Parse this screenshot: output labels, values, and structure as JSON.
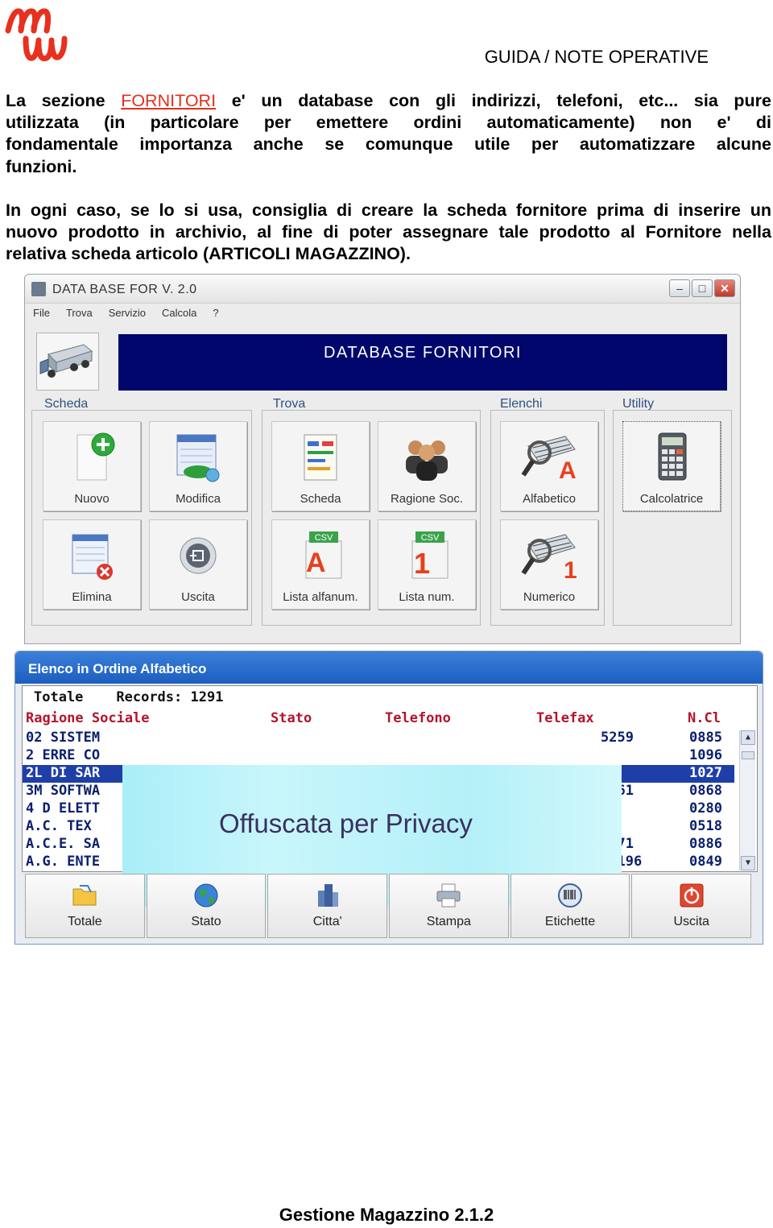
{
  "header": {
    "logo_text": "mw",
    "title": "GUIDA / NOTE OPERATIVE"
  },
  "intro": {
    "p1_before": "La sezione",
    "p1_link": "FORNITORI",
    "p1_l1_rest": "e' un database con gli indirizzi, telefoni, etc... sia pure",
    "p1_l2": "utilizzata (in particolare per emettere ordini automaticamente) non e' di",
    "p1_l3": "fondamentale importanza  anche se comunque utile per automatizzare alcune",
    "p1_l4": "funzioni.",
    "p2_l1": "In ogni caso, se lo si usa, consiglia di creare la scheda fornitore prima di inserire un",
    "p2_l2": "nuovo prodotto in archivio, al fine di poter assegnare tale prodotto al Fornitore nella",
    "p2_l3": "relativa scheda articolo (ARTICOLI MAGAZZINO)."
  },
  "window1": {
    "title": "DATA BASE FOR  V. 2.0",
    "menu": [
      "File",
      "Trova",
      "Servizio",
      "Calcola",
      "?"
    ],
    "banner": "DATABASE FORNITORI",
    "groups": {
      "scheda": "Scheda",
      "trova": "Trova",
      "elenchi": "Elenchi",
      "utility": "Utility"
    },
    "tiles": {
      "nuovo": "Nuovo",
      "modifica": "Modifica",
      "elimina": "Elimina",
      "uscita": "Uscita",
      "scheda": "Scheda",
      "ragione_soc": "Ragione Soc.",
      "lista_alfanum": "Lista alfanum.",
      "lista_num": "Lista num.",
      "alfabetico": "Alfabetico",
      "numerico": "Numerico",
      "calcolatrice": "Calcolatrice",
      "csv": "CSV"
    }
  },
  "window2": {
    "title": "Elenco in Ordine Alfabetico",
    "totals_label": "Totale",
    "records_label": "Records:",
    "records_count": "1291",
    "columns": [
      "Ragione Sociale",
      "Stato",
      "Telefono",
      "Telefax",
      "N.Cl"
    ],
    "rows": [
      {
        "name": "02 SISTEM",
        "fax": "5259",
        "ncl": "0885"
      },
      {
        "name": "2 ERRE CO",
        "fax": "",
        "ncl": "1096"
      },
      {
        "name": "2L DI SAR",
        "fax": "",
        "ncl": "1027"
      },
      {
        "name": "3M SOFTWA",
        "fax": "9161",
        "ncl": "0868"
      },
      {
        "name": "4 D ELETT",
        "fax": "",
        "ncl": "0280"
      },
      {
        "name": "A.C. TEX",
        "fax": "",
        "ncl": "0518"
      },
      {
        "name": "A.C.E. SA",
        "fax": "3371",
        "ncl": "0886"
      },
      {
        "name": "A.G. ENTE",
        "fax": "33196",
        "ncl": "0849"
      }
    ],
    "privacy_overlay": "Offuscata per Privacy",
    "buttons": {
      "totale": "Totale",
      "stato": "Stato",
      "citta": "Citta'",
      "stampa": "Stampa",
      "etichette": "Etichette",
      "uscita": "Uscita"
    }
  },
  "footer": "Gestione Magazzino  2.1.2",
  "colors": {
    "link": "#e0301e",
    "banner": "#00066b",
    "list_text": "#0a1f6e",
    "list_header": "#b3142b"
  }
}
